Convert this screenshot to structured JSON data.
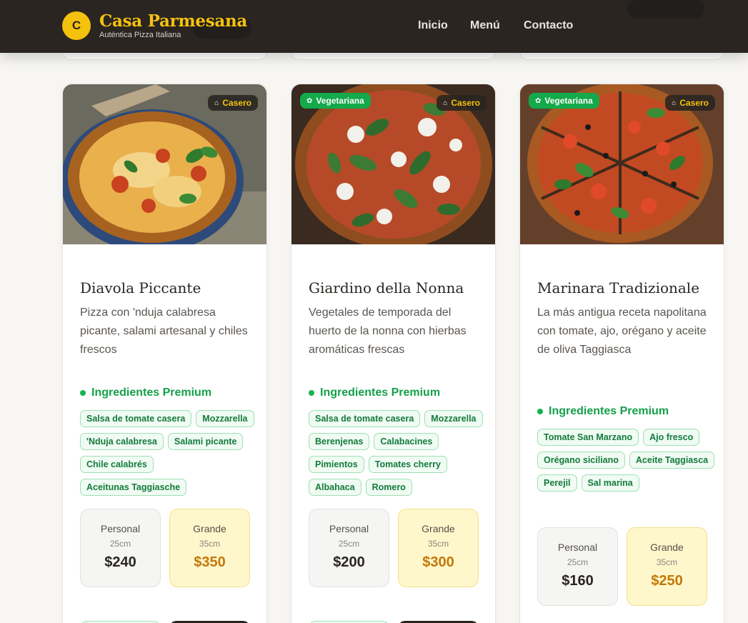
{
  "header": {
    "logo_letter": "C",
    "brand_name": "Casa Parmesana",
    "tagline": "Auténtica Pizza Italiana",
    "nav": [
      "Inicio",
      "Menú",
      "Contacto"
    ]
  },
  "colors": {
    "header_bg": "#2a2521",
    "accent_gold": "#f4c20d",
    "veg_green": "#14a94a",
    "chip_green": "#147a3b",
    "price_gold": "#c27808"
  },
  "ingredients_heading": "Ingredientes Premium",
  "cards": [
    {
      "title": "Diavola Piccante",
      "description": "Pizza con 'nduja calabresa picante, salami artesanal y chiles frescos",
      "badges": {
        "vegetariana": null,
        "casero": "Casero"
      },
      "ingredients": [
        "Salsa de tomate casera",
        "Mozzarella",
        "'Nduja calabresa",
        "Salami picante",
        "Chile calabrés",
        "Aceitunas Taggiasche"
      ],
      "personal": {
        "label": "Personal",
        "size": "25cm",
        "price": "$240"
      },
      "grande": {
        "label": "Grande",
        "size": "35cm",
        "price": "$350"
      }
    },
    {
      "title": "Giardino della Nonna",
      "description": "Vegetales de temporada del huerto de la nonna con hierbas aromáticas frescas",
      "badges": {
        "vegetariana": "Vegetariana",
        "casero": "Casero"
      },
      "ingredients": [
        "Salsa de tomate casera",
        "Mozzarella",
        "Berenjenas",
        "Calabacines",
        "Pimientos",
        "Tomates cherry",
        "Albahaca",
        "Romero"
      ],
      "personal": {
        "label": "Personal",
        "size": "25cm",
        "price": "$200"
      },
      "grande": {
        "label": "Grande",
        "size": "35cm",
        "price": "$300"
      }
    },
    {
      "title": "Marinara Tradizionale",
      "description": "La más antigua receta napolitana con tomate, ajo, orégano y aceite de oliva Taggiasca",
      "badges": {
        "vegetariana": "Vegetariana",
        "casero": "Casero"
      },
      "ingredients": [
        "Tomate San Marzano",
        "Ajo fresco",
        "Orégano siciliano",
        "Aceite Taggiasca",
        "Perejil",
        "Sal marina"
      ],
      "personal": {
        "label": "Personal",
        "size": "25cm",
        "price": "$160"
      },
      "grande": {
        "label": "Grande",
        "size": "35cm",
        "price": "$250"
      }
    }
  ]
}
